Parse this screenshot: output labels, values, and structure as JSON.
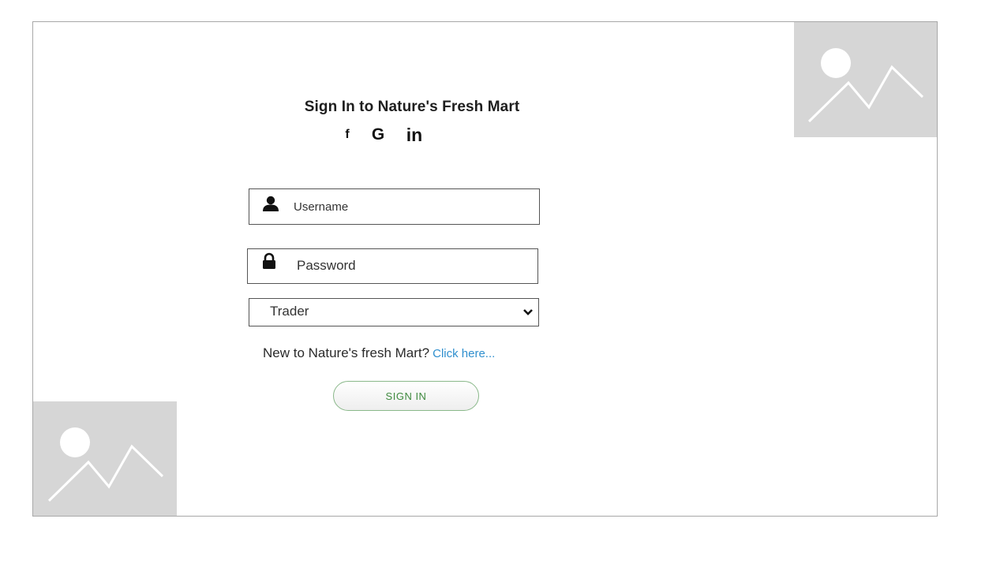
{
  "login": {
    "title": "Sign In to Nature's Fresh Mart",
    "social": {
      "facebook": "f",
      "google": "G",
      "linkedin": "in"
    },
    "username": {
      "placeholder": "Username",
      "icon": "user-icon"
    },
    "password": {
      "placeholder": "Password",
      "icon": "lock-icon"
    },
    "role_select": {
      "selected": "Trader",
      "icon": "chevron-down-icon"
    },
    "register": {
      "prompt": "New to Nature's fresh Mart?",
      "link": "Click here..."
    },
    "signin_label": "SIGN IN"
  },
  "colors": {
    "placeholder_bg": "#d6d6d6",
    "link": "#2f8fce",
    "signin_text": "#3f8a3f",
    "signin_border": "#8ab88a"
  }
}
